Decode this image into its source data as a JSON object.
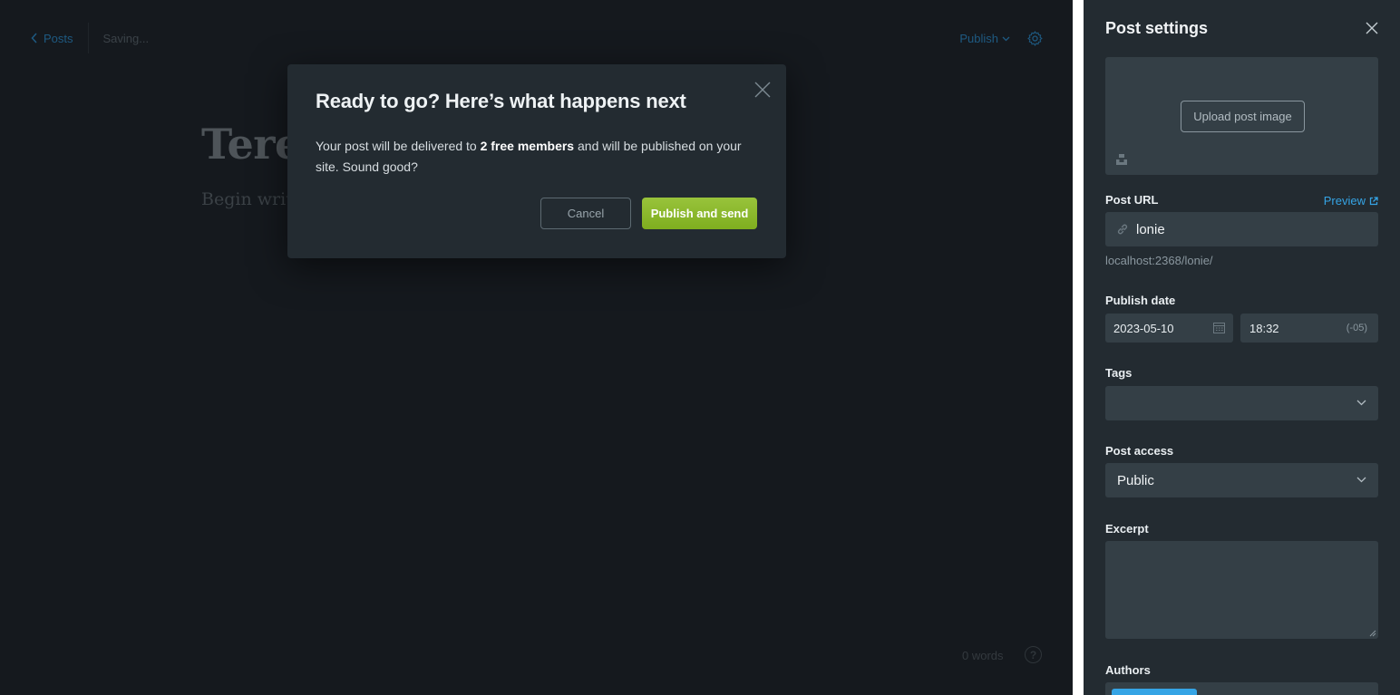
{
  "editor": {
    "back_label": "Posts",
    "status": "Saving...",
    "publish_label": "Publish",
    "title_visible": "Teren",
    "body_placeholder": "Begin writ",
    "word_count": "0 words",
    "help_glyph": "?"
  },
  "modal": {
    "title": "Ready to go? Here’s what happens next",
    "text_before": "Your post will be delivered to ",
    "text_bold": "2 free members",
    "text_after": " and will be published on your site. Sound good?",
    "cancel_label": "Cancel",
    "confirm_label": "Publish and send"
  },
  "settings": {
    "title": "Post settings",
    "upload_label": "Upload post image",
    "url_label": "Post URL",
    "preview_label": "Preview",
    "slug": "lonie",
    "url_hint": "localhost:2368/lonie/",
    "publish_date_label": "Publish date",
    "date_value": "2023-05-10",
    "time_value": "18:32",
    "timezone": "(-05)",
    "tags_label": "Tags",
    "access_label": "Post access",
    "access_value": "Public",
    "excerpt_label": "Excerpt",
    "authors_label": "Authors"
  },
  "colors": {
    "accent_blue": "#35a4e5",
    "publish_green": "#8bb92c",
    "panel_bg": "#232b31",
    "editor_bg": "#15191e"
  }
}
